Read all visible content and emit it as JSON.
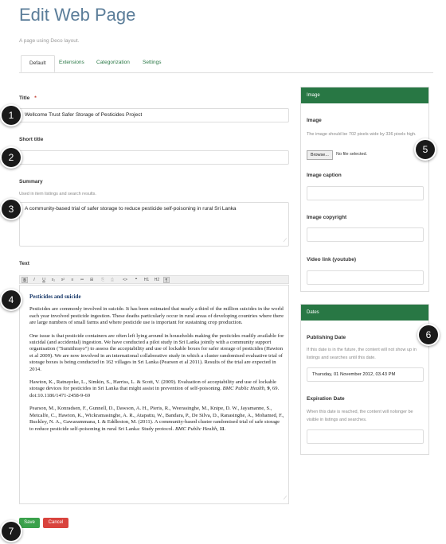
{
  "page": {
    "title": "Edit Web Page",
    "subtitle": "A page using Deco layout."
  },
  "tabs": [
    {
      "label": "Default",
      "active": true
    },
    {
      "label": "Extensions",
      "active": false
    },
    {
      "label": "Categorization",
      "active": false
    },
    {
      "label": "Settings",
      "active": false
    }
  ],
  "form": {
    "title": {
      "label": "Title",
      "required_mark": "*",
      "value": "Wellcome Trust Safer Storage of Pesticides Project"
    },
    "short_title": {
      "label": "Short title",
      "value": ""
    },
    "summary": {
      "label": "Summary",
      "help": "Used in item listings and search results.",
      "value": "A community-based trial of safer storage to reduce pesticide self-poisoning in rural Sri Lanka"
    },
    "text": {
      "label": "Text",
      "toolbar": [
        "B",
        "I",
        "U",
        "x₂",
        "x²",
        "≡",
        "≔",
        "⊞",
        "⎘",
        "⎙",
        "<>",
        "❝",
        "H1",
        "H2",
        "¶"
      ],
      "heading": "Pesticides and suicide",
      "paragraphs": [
        "Pesticides are commonly involved in suicide.  It has been estimated that nearly a third of the million suicides in the world each year involved pesticide ingestion.  These deaths particularly occur in rural areas of developing countries where there are large numbers of small farms and where pesticide use is important for sustaining crop production.",
        "One issue is that pesticide containers are often left lying around in households making the pesticides readily available for suicidal (and accidental) ingestion.  We have conducted a pilot study in Sri Lanka jointly with a community support organisation (\"Sumithrayo\") to assess the acceptability and use of lockable boxes for safer storage of pesticides (Hawton et al 2009).  We are now involved in an international collaborative study in which a cluster randomised evaluative trial of storage boxes is being conducted in 162 villages in Sri Lanka (Pearson et al 2011).  Results of the trial are expected in 2014."
      ],
      "ref1": {
        "text": "Hawton, K., Ratnayeke, L., Simkin, S., Harriss, L. & Scott, V. (2009). Evaluation of acceptability and use of lockable storage devices for pesticides in Sri Lanka that might assist in prevention of self-poisoning. ",
        "journal": "BMC Public Health,",
        "volume": " 9",
        "rest": ", 69. doi:10.1186/1471-2458-9-69"
      },
      "ref2": {
        "text": "Pearson, M., Konradsen, F., Gunnell, D., Dawson, A. H., Pieris, R., Weerasinghe, M., Knipe, D. W., Jayamanne, S., Metcalfe, C., Hawton, K., Wickramasinghe, A. R., Atapattu, W., Bandara, P., De Silva, D., Ranasinghe, A., Mohamed, F., Buckley, N. A., Gawarammana, I. & Eddleston, M. (2011). A community-based cluster randomised trial of safe storage to reduce pesticide self-poisoning in rural Sri Lanka: Study protocol. ",
        "journal": "BMC Public Health,",
        "volume": " 11",
        "rest": "."
      }
    }
  },
  "image_panel": {
    "header": "Image",
    "image_label": "Image",
    "image_help": "The image should be 702 pixels wide by 336 pixels high.",
    "browse_button": "Browse...",
    "no_file": "No file selected.",
    "caption_label": "Image caption",
    "copyright_label": "Image copyright",
    "video_label": "Video link (youtube)"
  },
  "dates_panel": {
    "header": "Dates",
    "publishing_label": "Publishing Date",
    "publishing_help": "If this date is in the future, the content will not show up in listings and searches until this date.",
    "publishing_value": "Thursday, 01 November 2012, 03.43 PM",
    "expiration_label": "Expiration Date",
    "expiration_help": "When this date is reached, the content will nolonger be visible in listings and searches."
  },
  "actions": {
    "save": "Save",
    "cancel": "Cancel"
  },
  "callouts": [
    "1",
    "2",
    "3",
    "4",
    "5",
    "6",
    "7"
  ],
  "colors": {
    "accent": "#287744",
    "title": "#5b7d99",
    "save": "#3aa14b",
    "cancel": "#d9433d",
    "required": "#c0392b"
  }
}
